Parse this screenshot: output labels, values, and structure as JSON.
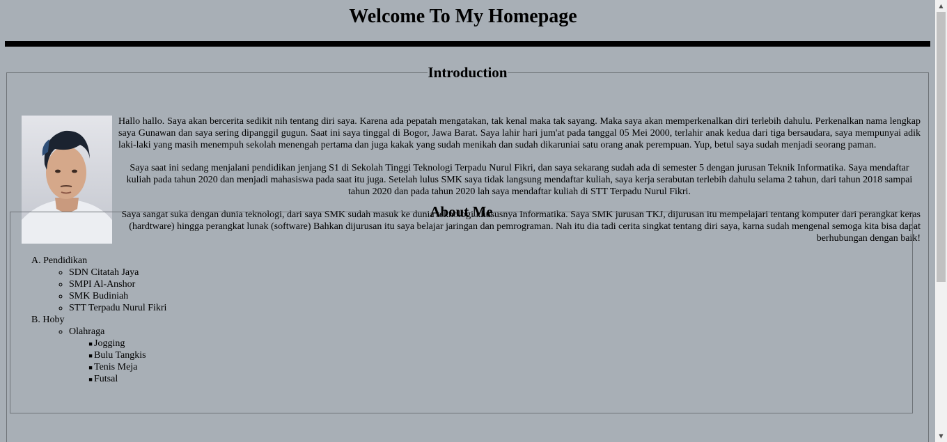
{
  "page": {
    "title": "Welcome To My Homepage"
  },
  "intro": {
    "legend": "Introduction",
    "avatar_icon": "profile-photo",
    "paragraphs": [
      "Hallo hallo. Saya akan bercerita sedikit nih tentang diri saya. Karena ada pepatah mengatakan, tak kenal maka tak sayang. Maka saya akan memperkenalkan diri terlebih dahulu. Perkenalkan nama lengkap saya Gunawan dan saya sering dipanggil gugun. Saat ini saya tinggal di Bogor, Jawa Barat. Saya lahir hari jum'at pada tanggal 05 Mei 2000, terlahir anak kedua dari tiga bersaudara, saya mempunyai adik laki-laki yang masih menempuh sekolah menengah pertama dan juga kakak yang sudah menikah dan sudah dikaruniai satu orang anak perempuan. Yup, betul saya sudah menjadi seorang paman.",
      "Saya saat ini sedang menjalani pendidikan jenjang S1 di Sekolah Tinggi Teknologi Terpadu Nurul Fikri, dan saya sekarang sudah ada di semester 5 dengan jurusan Teknik Informatika. Saya mendaftar kuliah pada tahun 2020 dan menjadi mahasiswa pada saat itu juga. Setelah lulus SMK saya tidak langsung mendaftar kuliah, saya kerja serabutan terlebih dahulu selama 2 tahun, dari tahun 2018 sampai tahun 2020 dan pada tahun 2020 lah saya mendaftar kuliah di STT Terpadu Nurul Fikri.",
      "Saya sangat suka dengan dunia teknologi, dari saya SMK sudah masuk ke dunia teknologi khususnya Informatika. Saya SMK jurusan TKJ, dijurusan itu mempelajari tentang komputer dari perangkat keras (hardtware) hingga perangkat lunak (software) Bahkan dijurusan itu saya belajar jaringan dan pemrograman. Nah itu dia tadi cerita singkat tentang diri saya, karna sudah mengenal semoga kita bisa dapat berhubungan dengan baik!"
    ]
  },
  "about": {
    "legend": "About Me",
    "sections": [
      {
        "marker": "A.",
        "label": "Pendidikan",
        "items": [
          "SDN Citatah Jaya",
          "SMPI Al-Anshor",
          "SMK Budiniah",
          "STT Terpadu Nurul Fikri"
        ]
      },
      {
        "marker": "B.",
        "label": "Hoby",
        "sub_label": "Olahraga",
        "items": [
          "Jogging",
          "Bulu Tangkis",
          "Tenis Meja",
          "Futsal"
        ]
      }
    ]
  },
  "colors": {
    "background": "#a8afb6",
    "rule": "#000000",
    "border": "#6e7378"
  }
}
